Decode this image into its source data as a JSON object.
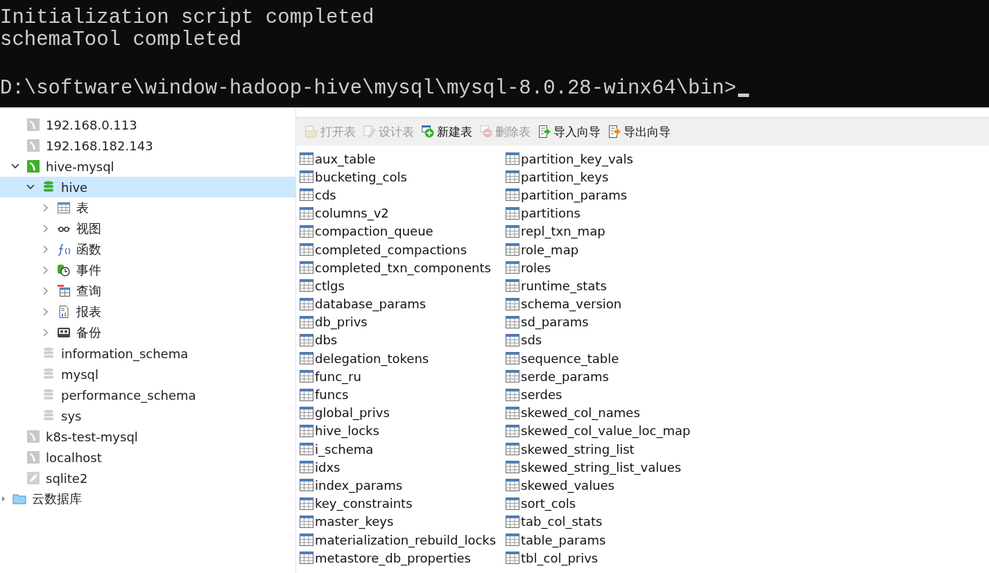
{
  "terminal": {
    "lines": [
      "Initialization script completed",
      "schemaTool completed",
      "D:\\software\\window-hadoop-hive\\mysql\\mysql-8.0.28-winx64\\bin>"
    ]
  },
  "navigator": {
    "items": [
      {
        "label": "192.168.0.113",
        "kind": "connection",
        "active": false,
        "selected": false
      },
      {
        "label": "192.168.182.143",
        "kind": "connection",
        "active": false,
        "selected": false
      },
      {
        "label": "hive-mysql",
        "kind": "connection",
        "active": true,
        "selected": false,
        "expanded": true,
        "children": [
          {
            "label": "hive",
            "kind": "database",
            "active": true,
            "selected": true,
            "expanded": true,
            "children": [
              {
                "label": "表",
                "kind": "tables",
                "selected": false,
                "expanded": false
              },
              {
                "label": "视图",
                "kind": "views",
                "selected": false,
                "expanded": false
              },
              {
                "label": "函数",
                "kind": "functions",
                "selected": false,
                "expanded": false
              },
              {
                "label": "事件",
                "kind": "events",
                "selected": false,
                "expanded": false
              },
              {
                "label": "查询",
                "kind": "queries",
                "selected": false,
                "expanded": false
              },
              {
                "label": "报表",
                "kind": "reports",
                "selected": false,
                "expanded": false
              },
              {
                "label": "备份",
                "kind": "backups",
                "selected": false,
                "expanded": false
              }
            ]
          },
          {
            "label": "information_schema",
            "kind": "database",
            "active": false,
            "selected": false
          },
          {
            "label": "mysql",
            "kind": "database",
            "active": false,
            "selected": false
          },
          {
            "label": "performance_schema",
            "kind": "database",
            "active": false,
            "selected": false
          },
          {
            "label": "sys",
            "kind": "database",
            "active": false,
            "selected": false
          }
        ]
      },
      {
        "label": "k8s-test-mysql",
        "kind": "connection",
        "active": false,
        "selected": false
      },
      {
        "label": "localhost",
        "kind": "connection",
        "active": false,
        "selected": false
      },
      {
        "label": "sqlite2",
        "kind": "sqlite",
        "active": false,
        "selected": false
      },
      {
        "label": "云数据库",
        "kind": "folder",
        "selected": false,
        "expanded": false
      }
    ]
  },
  "toolbar": [
    {
      "label": "打开表",
      "kind": "open",
      "disabled": true
    },
    {
      "label": "设计表",
      "kind": "design",
      "disabled": true
    },
    {
      "label": "新建表",
      "kind": "new",
      "disabled": false
    },
    {
      "label": "删除表",
      "kind": "delete",
      "disabled": true
    },
    {
      "label": "导入向导",
      "kind": "import",
      "disabled": false
    },
    {
      "label": "导出向导",
      "kind": "export",
      "disabled": false
    }
  ],
  "tables": [
    [
      "aux_table",
      "bucketing_cols",
      "cds",
      "columns_v2",
      "compaction_queue",
      "completed_compactions",
      "completed_txn_components",
      "ctlgs",
      "database_params",
      "db_privs",
      "dbs",
      "delegation_tokens",
      "func_ru",
      "funcs",
      "global_privs",
      "hive_locks",
      "i_schema",
      "idxs",
      "index_params",
      "key_constraints",
      "master_keys",
      "materialization_rebuild_locks",
      "metastore_db_properties"
    ],
    [
      "partition_key_vals",
      "partition_keys",
      "partition_params",
      "partitions",
      "repl_txn_map",
      "role_map",
      "roles",
      "runtime_stats",
      "schema_version",
      "sd_params",
      "sds",
      "sequence_table",
      "serde_params",
      "serdes",
      "skewed_col_names",
      "skewed_col_value_loc_map",
      "skewed_string_list",
      "skewed_string_list_values",
      "skewed_values",
      "sort_cols",
      "tab_col_stats",
      "table_params",
      "tbl_col_privs"
    ]
  ]
}
